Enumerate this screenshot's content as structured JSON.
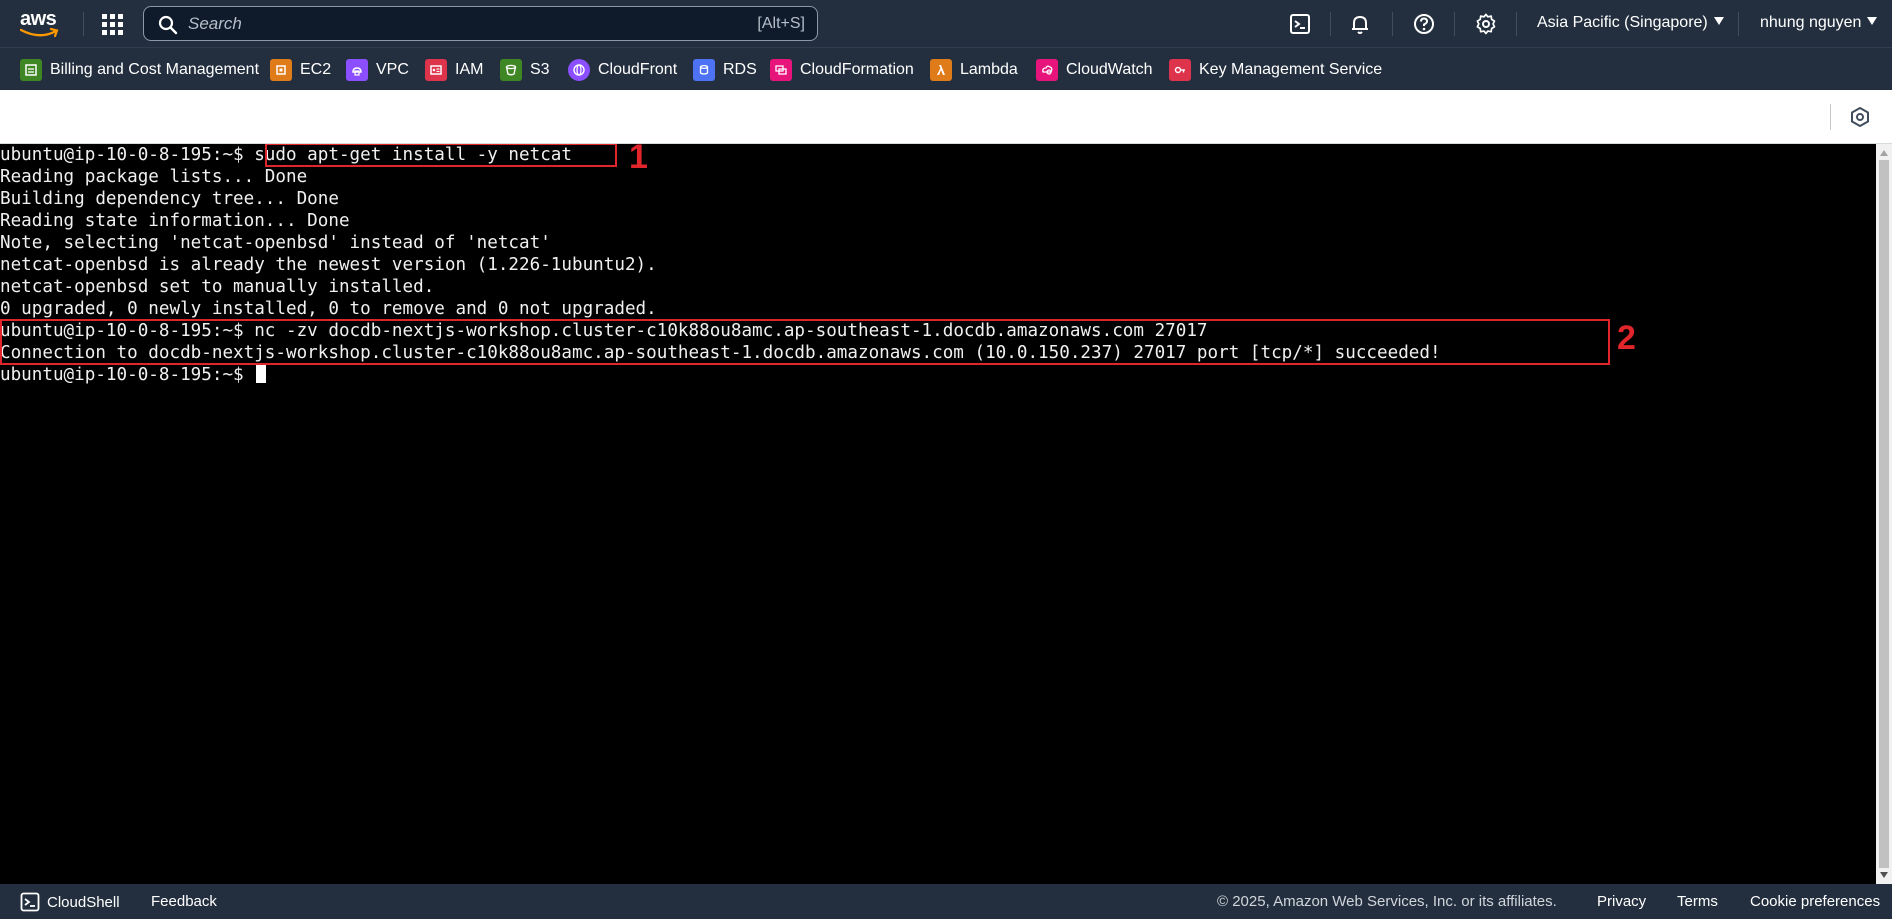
{
  "topnav": {
    "logo_text": "aws",
    "search_placeholder": "Search",
    "search_shortcut": "[Alt+S]",
    "icons": [
      "cloudshell-icon",
      "bell-icon",
      "help-icon",
      "gear-icon"
    ],
    "region": "Asia Pacific (Singapore)",
    "user": "nhung nguyen"
  },
  "favorites": [
    {
      "label": "Billing and Cost Management",
      "color": "#3f8624"
    },
    {
      "label": "EC2",
      "color": "#e07b1a"
    },
    {
      "label": "VPC",
      "color": "#8c4fff"
    },
    {
      "label": "IAM",
      "color": "#dd344c"
    },
    {
      "label": "S3",
      "color": "#3f8624"
    },
    {
      "label": "CloudFront",
      "color": "#8c4fff"
    },
    {
      "label": "RDS",
      "color": "#4d72f3"
    },
    {
      "label": "CloudFormation",
      "color": "#e7157b"
    },
    {
      "label": "Lambda",
      "color": "#e07b1a"
    },
    {
      "label": "CloudWatch",
      "color": "#e7157b"
    },
    {
      "label": "Key Management Service",
      "color": "#dd344c"
    }
  ],
  "terminal": {
    "lines": [
      {
        "prompt": "ubuntu@ip-10-0-8-195:~$ ",
        "text": "sudo apt-get install -y netcat"
      },
      {
        "prompt": "",
        "text": "Reading package lists... Done"
      },
      {
        "prompt": "",
        "text": "Building dependency tree... Done"
      },
      {
        "prompt": "",
        "text": "Reading state information... Done"
      },
      {
        "prompt": "",
        "text": "Note, selecting 'netcat-openbsd' instead of 'netcat'"
      },
      {
        "prompt": "",
        "text": "netcat-openbsd is already the newest version (1.226-1ubuntu2)."
      },
      {
        "prompt": "",
        "text": "netcat-openbsd set to manually installed."
      },
      {
        "prompt": "",
        "text": "0 upgraded, 0 newly installed, 0 to remove and 0 not upgraded."
      },
      {
        "prompt": "ubuntu@ip-10-0-8-195:~$ ",
        "text": "nc -zv docdb-nextjs-workshop.cluster-c10k88ou8amc.ap-southeast-1.docdb.amazonaws.com 27017"
      },
      {
        "prompt": "",
        "text": "Connection to docdb-nextjs-workshop.cluster-c10k88ou8amc.ap-southeast-1.docdb.amazonaws.com (10.0.150.237) 27017 port [tcp/*] succeeded!"
      },
      {
        "prompt": "ubuntu@ip-10-0-8-195:~$ ",
        "text": ""
      }
    ],
    "annotations": [
      "1",
      "2"
    ],
    "annotation_color": "#e0252b"
  },
  "footer": {
    "cloudshell": "CloudShell",
    "feedback": "Feedback",
    "copyright": "© 2025, Amazon Web Services, Inc. or its affiliates.",
    "privacy": "Privacy",
    "terms": "Terms",
    "cookies": "Cookie preferences"
  }
}
